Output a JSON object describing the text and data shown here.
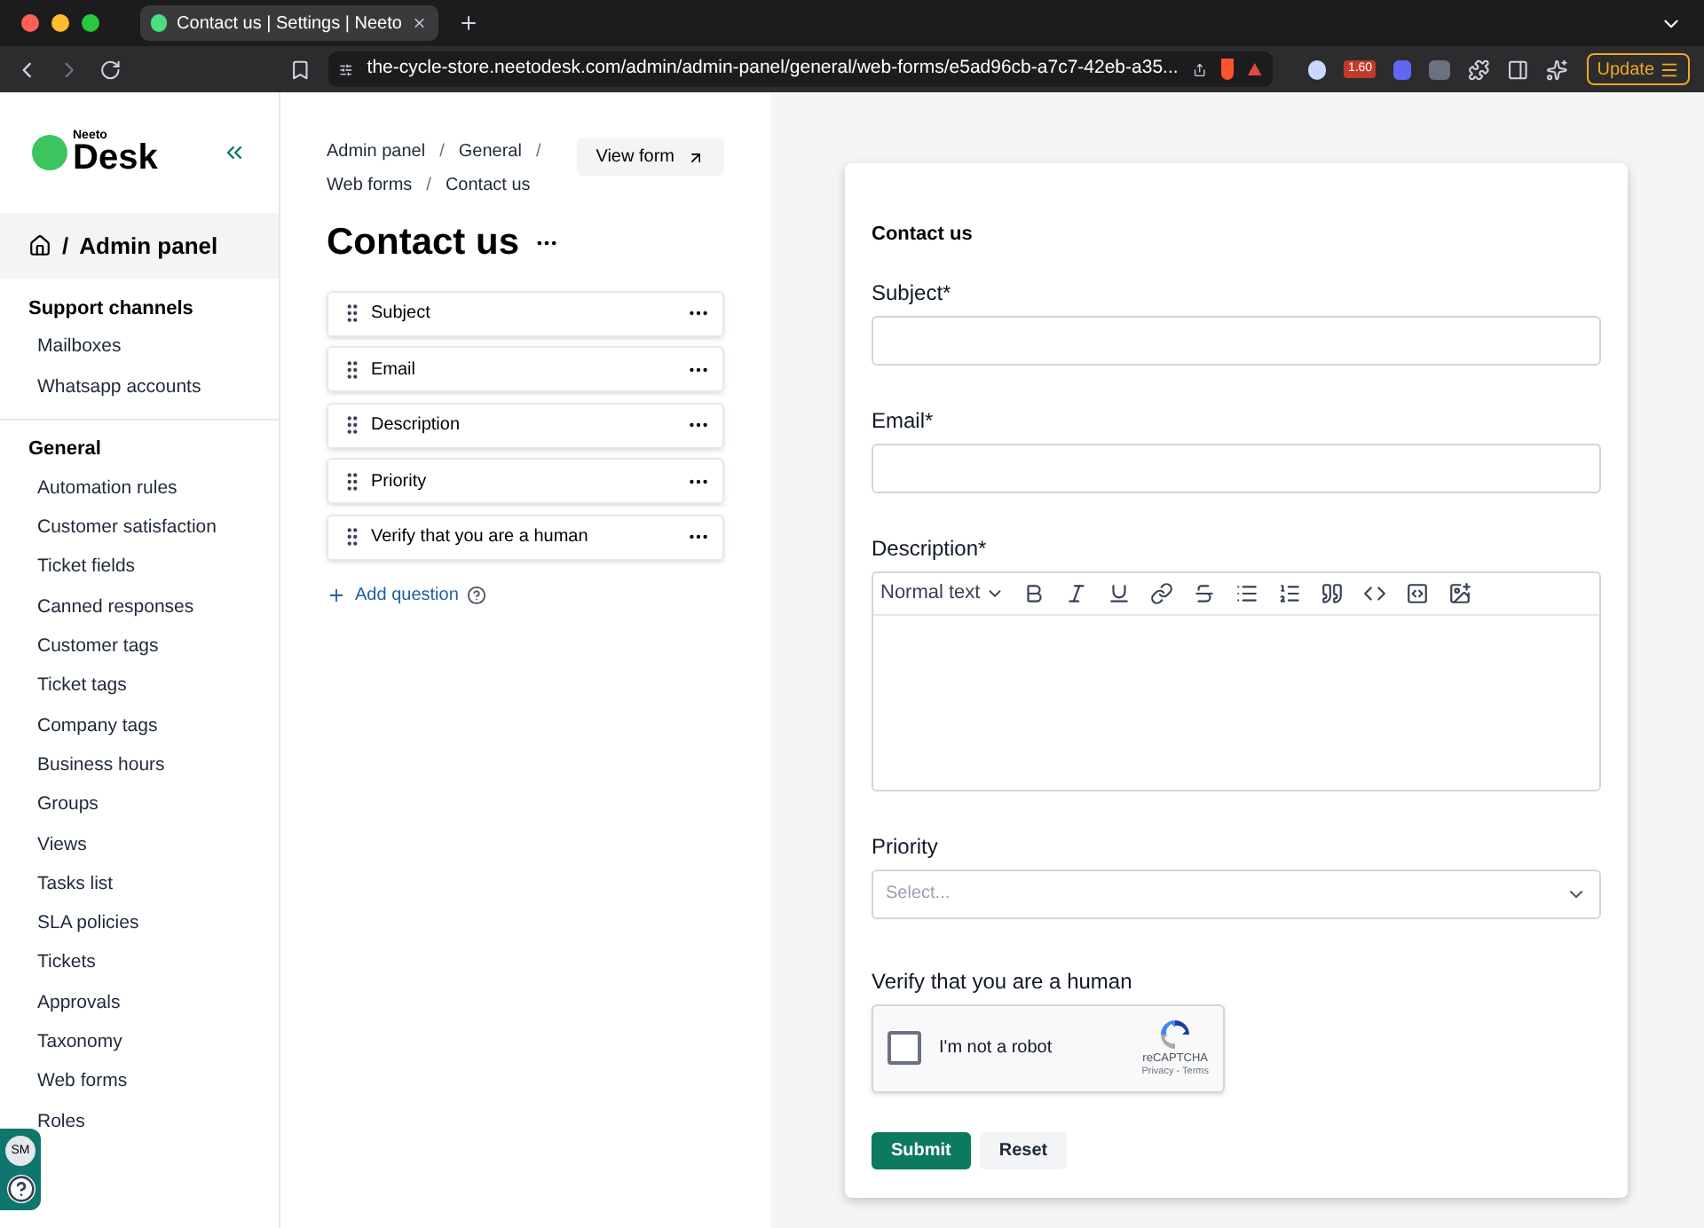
{
  "browser": {
    "tab_title": "Contact us | Settings | Neeto",
    "url": "the-cycle-store.neetodesk.com/admin/admin-panel/general/web-forms/e5ad96cb-a7c7-42eb-a35...",
    "extension_badge": "1.60",
    "update_button": "Update"
  },
  "sidebar": {
    "logo_small": "Neeto",
    "logo_big": "Desk",
    "breadcrumb_separator": "/",
    "breadcrumb": "Admin panel",
    "sections": [
      {
        "title": "Support channels",
        "items": [
          "Mailboxes",
          "Whatsapp accounts"
        ]
      },
      {
        "title": "General",
        "items": [
          "Automation rules",
          "Customer satisfaction",
          "Ticket fields",
          "Canned responses",
          "Customer tags",
          "Ticket tags",
          "Company tags",
          "Business hours",
          "Groups",
          "Views",
          "Tasks list",
          "SLA policies",
          "Tickets",
          "Approvals",
          "Taxonomy",
          "Web forms",
          "Roles"
        ]
      }
    ],
    "avatar": "SM"
  },
  "editor": {
    "breadcrumbs": [
      [
        {
          "kind": "link",
          "text": "Admin panel"
        },
        {
          "kind": "separator",
          "text": "/"
        },
        {
          "kind": "link",
          "text": "General"
        },
        {
          "kind": "separator",
          "text": "/"
        }
      ],
      [
        {
          "kind": "link",
          "text": "Web forms"
        },
        {
          "kind": "separator",
          "text": "/"
        },
        {
          "kind": "link",
          "text": "Contact us"
        }
      ]
    ],
    "view_form_button": "View form",
    "title": "Contact us",
    "questions": [
      "Subject",
      "Email",
      "Description",
      "Priority",
      "Verify that you are a human"
    ],
    "add_question": "Add question"
  },
  "preview": {
    "title": "Contact us",
    "fields": [
      {
        "kind": "text",
        "label": "Subject*"
      },
      {
        "kind": "text",
        "label": "Email*"
      },
      {
        "kind": "richtext",
        "label": "Description*",
        "format": "Normal text"
      },
      {
        "kind": "select",
        "label": "Priority",
        "placeholder": "Select..."
      },
      {
        "kind": "captcha",
        "label": "Verify that you are a human",
        "checkbox_label": "I'm not a robot",
        "checked": false,
        "brand": "reCAPTCHA",
        "links": "Privacy - Terms"
      }
    ],
    "submit": "Submit",
    "reset": "Reset"
  }
}
